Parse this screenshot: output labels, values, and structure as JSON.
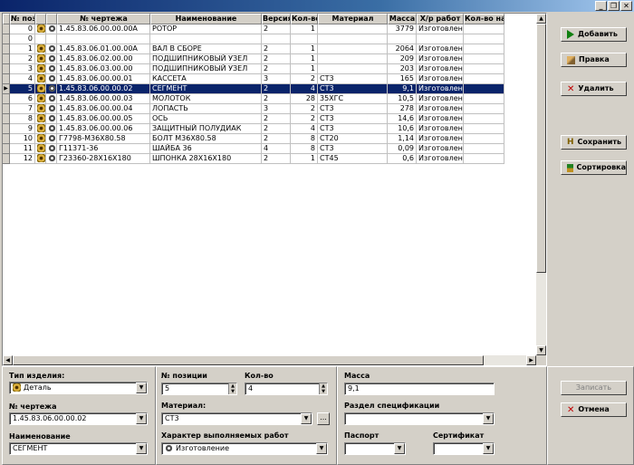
{
  "window": {
    "btn_min": "_",
    "btn_restore": "❐",
    "btn_close": "✕"
  },
  "grid": {
    "headers": [
      "№ поз",
      "№ чертежа",
      "Наименование",
      "Версия",
      "Кол-во",
      "Материал",
      "Масса",
      "Х/р работ",
      "Кол-во на :"
    ],
    "rows": [
      {
        "pos": "0",
        "icons": true,
        "draw": "1.45.83.06.00.00.00А",
        "name": "РОТОР",
        "ver": "2",
        "qty": "1",
        "mat": "",
        "mass": "3779",
        "work": "Изготовление"
      },
      {
        "pos": "0",
        "icons": false,
        "draw": "",
        "name": "",
        "ver": "",
        "qty": "",
        "mat": "",
        "mass": "",
        "work": ""
      },
      {
        "pos": "1",
        "icons": true,
        "draw": "1.45.83.06.01.00.00А",
        "name": "ВАЛ В СБОРЕ",
        "ver": "2",
        "qty": "1",
        "mat": "",
        "mass": "2064",
        "work": "Изготовление"
      },
      {
        "pos": "2",
        "icons": true,
        "draw": "1.45.83.06.02.00.00",
        "name": "ПОДШИПНИКОВЫЙ УЗЕЛ",
        "ver": "2",
        "qty": "1",
        "mat": "",
        "mass": "209",
        "work": "Изготовление"
      },
      {
        "pos": "3",
        "icons": true,
        "draw": "1.45.83.06.03.00.00",
        "name": "ПОДШИПНИКОВЫЙ УЗЕЛ",
        "ver": "2",
        "qty": "1",
        "mat": "",
        "mass": "203",
        "work": "Изготовление"
      },
      {
        "pos": "4",
        "icons": true,
        "draw": "1.45.83.06.00.00.01",
        "name": "КАССЕТА",
        "ver": "3",
        "qty": "2",
        "mat": "СТ3",
        "mass": "165",
        "work": "Изготовление"
      },
      {
        "pos": "5",
        "icons": true,
        "draw": "1.45.83.06.00.00.02",
        "name": "СЕГМЕНТ",
        "ver": "2",
        "qty": "4",
        "mat": "СТ3",
        "mass": "9,1",
        "work": "Изготовление",
        "selected": true
      },
      {
        "pos": "6",
        "icons": true,
        "draw": "1.45.83.06.00.00.03",
        "name": "МОЛОТОК",
        "ver": "2",
        "qty": "28",
        "mat": "35ХГС",
        "mass": "10,5",
        "work": "Изготовление"
      },
      {
        "pos": "7",
        "icons": true,
        "draw": "1.45.83.06.00.00.04",
        "name": "ЛОПАСТЬ",
        "ver": "3",
        "qty": "2",
        "mat": "СТ3",
        "mass": "278",
        "work": "Изготовление"
      },
      {
        "pos": "8",
        "icons": true,
        "draw": "1.45.83.06.00.00.05",
        "name": "ОСЬ",
        "ver": "2",
        "qty": "2",
        "mat": "СТ3",
        "mass": "14,6",
        "work": "Изготовление"
      },
      {
        "pos": "9",
        "icons": true,
        "draw": "1.45.83.06.00.00.06",
        "name": "ЗАЩИТНЫЙ ПОЛУДИАК",
        "ver": "2",
        "qty": "4",
        "mat": "СТ3",
        "mass": "10,6",
        "work": "Изготовление"
      },
      {
        "pos": "10",
        "icons": true,
        "draw": "Г7798-М36Х80.58",
        "name": "БОЛТ М36Х80.58",
        "ver": "2",
        "qty": "8",
        "mat": "СТ20",
        "mass": "1,14",
        "work": "Изготовление"
      },
      {
        "pos": "11",
        "icons": true,
        "draw": "Г11371-36",
        "name": "ШАЙБА 36",
        "ver": "4",
        "qty": "8",
        "mat": "СТ3",
        "mass": "0,09",
        "work": "Изготовление"
      },
      {
        "pos": "12",
        "icons": true,
        "draw": "Г23360-28Х16Х180",
        "name": "ШПОНКА 28Х16Х180",
        "ver": "2",
        "qty": "1",
        "mat": "СТ45",
        "mass": "0,6",
        "work": "Изготовление"
      }
    ]
  },
  "side": {
    "add": "Добавить",
    "edit": "Правка",
    "delete": "Удалить",
    "save": "Сохранить",
    "sort": "Сортировка",
    "write": "Записать",
    "cancel": "Отмена"
  },
  "form": {
    "type_label": "Тип изделия:",
    "type_value": "Деталь",
    "drawing_label": "№ чертежа",
    "drawing_value": "1.45.83.06.00.00.02",
    "name_label": "Наименование",
    "name_value": "СЕГМЕНТ",
    "pos_label": "№ позиции",
    "pos_value": "5",
    "qty_label": "Кол-во",
    "qty_value": "4",
    "material_label": "Материал:",
    "material_value": "СТ3",
    "material_btn": "...",
    "work_label": "Характер  выполняемых работ",
    "work_value": "Изготовление",
    "mass_label": "Масса",
    "mass_value": "9,1",
    "section_label": "Раздел спецификации",
    "section_value": "",
    "passport_label": "Паспорт",
    "passport_value": "",
    "cert_label": "Сертификат",
    "cert_value": ""
  }
}
